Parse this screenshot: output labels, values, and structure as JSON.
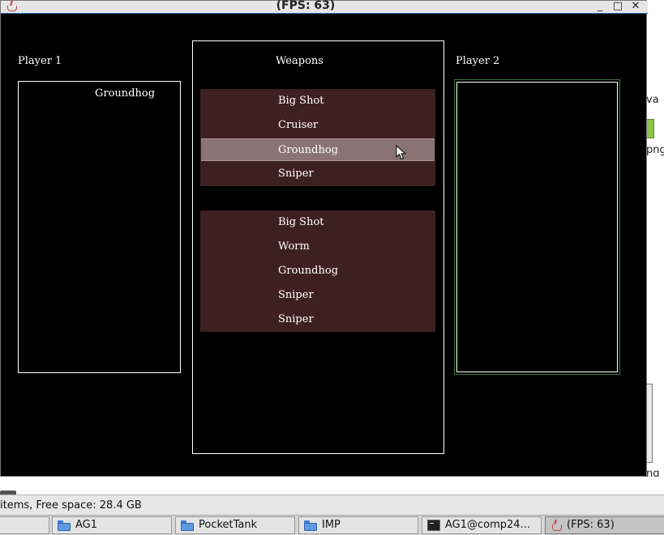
{
  "window": {
    "title": "(FPS: 63)",
    "controls": {
      "minimize": "_",
      "maximize": "□",
      "close": "✕"
    }
  },
  "game": {
    "player1": {
      "label": "Player 1",
      "selected_weapon": "Groundhog"
    },
    "player2": {
      "label": "Player 2",
      "selected_weapon": ""
    },
    "weapons_title": "Weapons",
    "list1": [
      {
        "label": "Big Shot",
        "selected": false
      },
      {
        "label": "Cruiser",
        "selected": false
      },
      {
        "label": "Groundhog",
        "selected": true
      },
      {
        "label": "Sniper",
        "selected": false
      }
    ],
    "list2": [
      {
        "label": "Big Shot",
        "selected": false
      },
      {
        "label": "Worm",
        "selected": false
      },
      {
        "label": "Groundhog",
        "selected": false
      },
      {
        "label": "Sniper",
        "selected": false
      },
      {
        "label": "Sniper",
        "selected": false
      }
    ]
  },
  "background": {
    "frag_va": "va",
    "frag_png": "png",
    "frag_ng": "ng"
  },
  "statusbar": {
    "text": "items, Free space: 28.4 GB"
  },
  "taskbar": {
    "items": [
      {
        "label": "",
        "icon": "none"
      },
      {
        "label": "AG1",
        "icon": "folder-icon"
      },
      {
        "label": "PocketTank",
        "icon": "folder-icon"
      },
      {
        "label": "IMP",
        "icon": "folder-icon"
      },
      {
        "label": "AG1@comp24...",
        "icon": "terminal-icon"
      },
      {
        "label": "(FPS: 63)",
        "icon": "java-icon",
        "active": true
      }
    ]
  },
  "colors": {
    "game_bg": "#000000",
    "list_bg": "#3f2020",
    "selected_bg": "#8a7373",
    "player2_focus": "#3a7a3a"
  }
}
